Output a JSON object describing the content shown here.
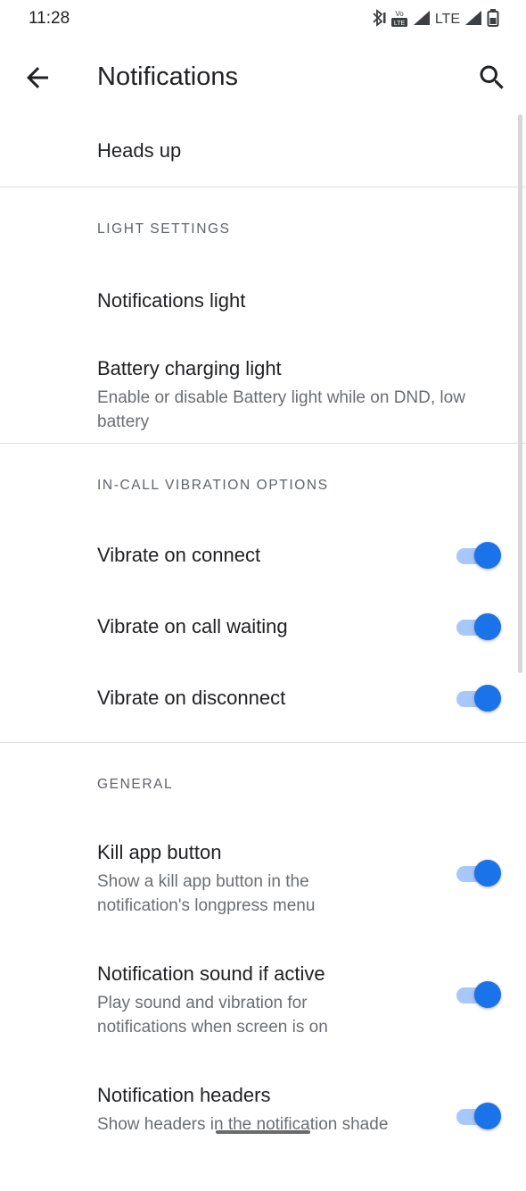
{
  "status_bar": {
    "time": "11:28",
    "network": "LTE",
    "volte_label": "Vo LTE"
  },
  "app_bar": {
    "title": "Notifications"
  },
  "top_item": {
    "title": "Heads up"
  },
  "sections": {
    "light": {
      "header": "LIGHT SETTINGS",
      "notifications_light": {
        "title": "Notifications light"
      },
      "battery_light": {
        "title": "Battery charging light",
        "summary": "Enable or disable Battery light while on DND, low battery"
      }
    },
    "incall": {
      "header": "IN-CALL VIBRATION OPTIONS",
      "vibrate_connect": {
        "title": "Vibrate on connect",
        "on": true
      },
      "vibrate_waiting": {
        "title": "Vibrate on call waiting",
        "on": true
      },
      "vibrate_disconnect": {
        "title": "Vibrate on disconnect",
        "on": true
      }
    },
    "general": {
      "header": "GENERAL",
      "kill_app": {
        "title": "Kill app button",
        "summary": "Show a kill app button in the notification's longpress menu",
        "on": true
      },
      "sound_active": {
        "title": "Notification sound if active",
        "summary": "Play sound and vibration for notifications when screen is on",
        "on": true
      },
      "headers": {
        "title": "Notification headers",
        "summary": "Show headers in the notification shade",
        "on": true
      }
    }
  },
  "colors": {
    "accent": "#1a73e8",
    "track": "#a8c7fa",
    "text_primary": "#202124",
    "text_secondary": "#6b6e72",
    "divider": "#dcdcdc"
  },
  "icons": {
    "back": "arrow-left-icon",
    "search": "search-icon",
    "bluetooth": "bluetooth-icon",
    "signal": "signal-icon",
    "battery": "battery-icon"
  }
}
